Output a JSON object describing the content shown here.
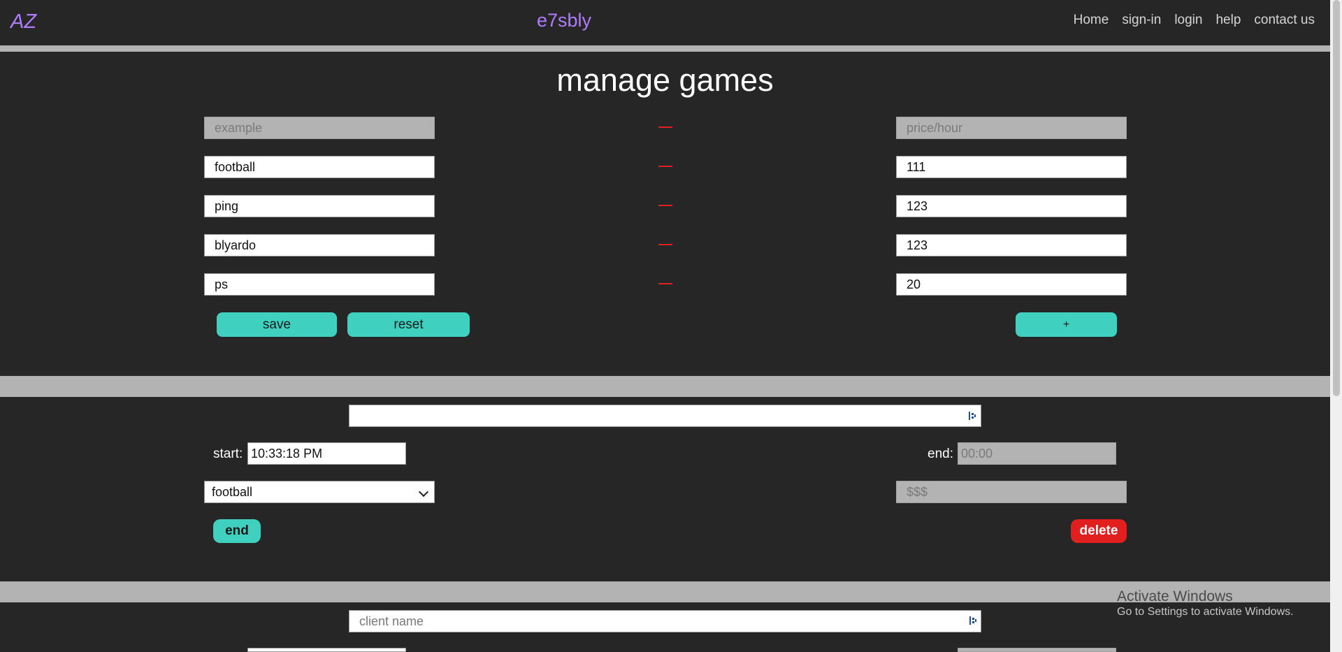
{
  "nav": {
    "logo": "AZ",
    "site_title": "e7sbly",
    "links": [
      "Home",
      "sign-in",
      "login",
      "help",
      "contact us"
    ]
  },
  "manage_games": {
    "title": "manage games",
    "header_row": {
      "name_placeholder": "example",
      "price_placeholder": "price/hour"
    },
    "rows": [
      {
        "name": "football",
        "price": "111"
      },
      {
        "name": "ping",
        "price": "123"
      },
      {
        "name": "blyardo",
        "price": "123"
      },
      {
        "name": "ps",
        "price": "20"
      }
    ],
    "save_label": "save",
    "reset_label": "reset",
    "add_label": "+"
  },
  "session1": {
    "client_name_value": "",
    "start_label": "start:",
    "start_value": "10:33:18 PM",
    "end_label": "end:",
    "end_placeholder": "00:00",
    "game_selected": "football",
    "price_placeholder": "$$$",
    "end_button_label": "end",
    "delete_button_label": "delete"
  },
  "session2": {
    "client_name_placeholder": "client name"
  },
  "watermark": {
    "title": "Activate Windows",
    "subtitle": "Go to Settings to activate Windows."
  },
  "colors": {
    "background": "#262626",
    "accent": "#b07cff",
    "teal": "#40d0c0",
    "danger": "#e21f1f",
    "band": "#b3b3b3"
  }
}
